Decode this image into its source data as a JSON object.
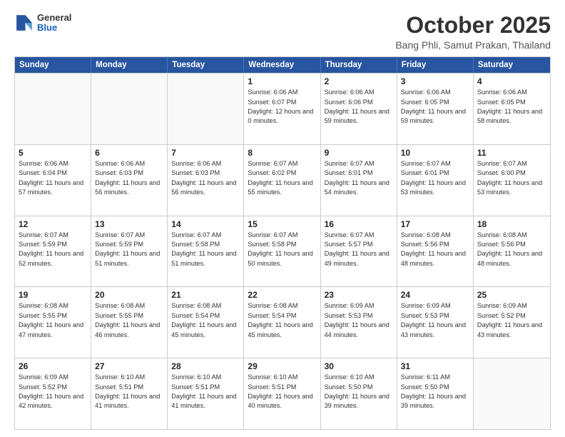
{
  "header": {
    "logo": {
      "general": "General",
      "blue": "Blue"
    },
    "title": "October 2025",
    "subtitle": "Bang Phli, Samut Prakan, Thailand"
  },
  "calendar": {
    "weekdays": [
      "Sunday",
      "Monday",
      "Tuesday",
      "Wednesday",
      "Thursday",
      "Friday",
      "Saturday"
    ],
    "rows": [
      [
        {
          "day": "",
          "empty": true
        },
        {
          "day": "",
          "empty": true
        },
        {
          "day": "",
          "empty": true
        },
        {
          "day": "1",
          "sunrise": "6:06 AM",
          "sunset": "6:07 PM",
          "daylight": "12 hours and 0 minutes."
        },
        {
          "day": "2",
          "sunrise": "6:06 AM",
          "sunset": "6:06 PM",
          "daylight": "11 hours and 59 minutes."
        },
        {
          "day": "3",
          "sunrise": "6:06 AM",
          "sunset": "6:05 PM",
          "daylight": "11 hours and 59 minutes."
        },
        {
          "day": "4",
          "sunrise": "6:06 AM",
          "sunset": "6:05 PM",
          "daylight": "11 hours and 58 minutes."
        }
      ],
      [
        {
          "day": "5",
          "sunrise": "6:06 AM",
          "sunset": "6:04 PM",
          "daylight": "11 hours and 57 minutes."
        },
        {
          "day": "6",
          "sunrise": "6:06 AM",
          "sunset": "6:03 PM",
          "daylight": "11 hours and 56 minutes."
        },
        {
          "day": "7",
          "sunrise": "6:06 AM",
          "sunset": "6:03 PM",
          "daylight": "11 hours and 56 minutes."
        },
        {
          "day": "8",
          "sunrise": "6:07 AM",
          "sunset": "6:02 PM",
          "daylight": "11 hours and 55 minutes."
        },
        {
          "day": "9",
          "sunrise": "6:07 AM",
          "sunset": "6:01 PM",
          "daylight": "11 hours and 54 minutes."
        },
        {
          "day": "10",
          "sunrise": "6:07 AM",
          "sunset": "6:01 PM",
          "daylight": "11 hours and 53 minutes."
        },
        {
          "day": "11",
          "sunrise": "6:07 AM",
          "sunset": "6:00 PM",
          "daylight": "11 hours and 53 minutes."
        }
      ],
      [
        {
          "day": "12",
          "sunrise": "6:07 AM",
          "sunset": "5:59 PM",
          "daylight": "11 hours and 52 minutes."
        },
        {
          "day": "13",
          "sunrise": "6:07 AM",
          "sunset": "5:59 PM",
          "daylight": "11 hours and 51 minutes."
        },
        {
          "day": "14",
          "sunrise": "6:07 AM",
          "sunset": "5:58 PM",
          "daylight": "11 hours and 51 minutes."
        },
        {
          "day": "15",
          "sunrise": "6:07 AM",
          "sunset": "5:58 PM",
          "daylight": "11 hours and 50 minutes."
        },
        {
          "day": "16",
          "sunrise": "6:07 AM",
          "sunset": "5:57 PM",
          "daylight": "11 hours and 49 minutes."
        },
        {
          "day": "17",
          "sunrise": "6:08 AM",
          "sunset": "5:56 PM",
          "daylight": "11 hours and 48 minutes."
        },
        {
          "day": "18",
          "sunrise": "6:08 AM",
          "sunset": "5:56 PM",
          "daylight": "11 hours and 48 minutes."
        }
      ],
      [
        {
          "day": "19",
          "sunrise": "6:08 AM",
          "sunset": "5:55 PM",
          "daylight": "11 hours and 47 minutes."
        },
        {
          "day": "20",
          "sunrise": "6:08 AM",
          "sunset": "5:55 PM",
          "daylight": "11 hours and 46 minutes."
        },
        {
          "day": "21",
          "sunrise": "6:08 AM",
          "sunset": "5:54 PM",
          "daylight": "11 hours and 45 minutes."
        },
        {
          "day": "22",
          "sunrise": "6:08 AM",
          "sunset": "5:54 PM",
          "daylight": "11 hours and 45 minutes."
        },
        {
          "day": "23",
          "sunrise": "6:09 AM",
          "sunset": "5:53 PM",
          "daylight": "11 hours and 44 minutes."
        },
        {
          "day": "24",
          "sunrise": "6:09 AM",
          "sunset": "5:53 PM",
          "daylight": "11 hours and 43 minutes."
        },
        {
          "day": "25",
          "sunrise": "6:09 AM",
          "sunset": "5:52 PM",
          "daylight": "11 hours and 43 minutes."
        }
      ],
      [
        {
          "day": "26",
          "sunrise": "6:09 AM",
          "sunset": "5:52 PM",
          "daylight": "11 hours and 42 minutes."
        },
        {
          "day": "27",
          "sunrise": "6:10 AM",
          "sunset": "5:51 PM",
          "daylight": "11 hours and 41 minutes."
        },
        {
          "day": "28",
          "sunrise": "6:10 AM",
          "sunset": "5:51 PM",
          "daylight": "11 hours and 41 minutes."
        },
        {
          "day": "29",
          "sunrise": "6:10 AM",
          "sunset": "5:51 PM",
          "daylight": "11 hours and 40 minutes."
        },
        {
          "day": "30",
          "sunrise": "6:10 AM",
          "sunset": "5:50 PM",
          "daylight": "11 hours and 39 minutes."
        },
        {
          "day": "31",
          "sunrise": "6:11 AM",
          "sunset": "5:50 PM",
          "daylight": "11 hours and 39 minutes."
        },
        {
          "day": "",
          "empty": true
        }
      ]
    ]
  }
}
